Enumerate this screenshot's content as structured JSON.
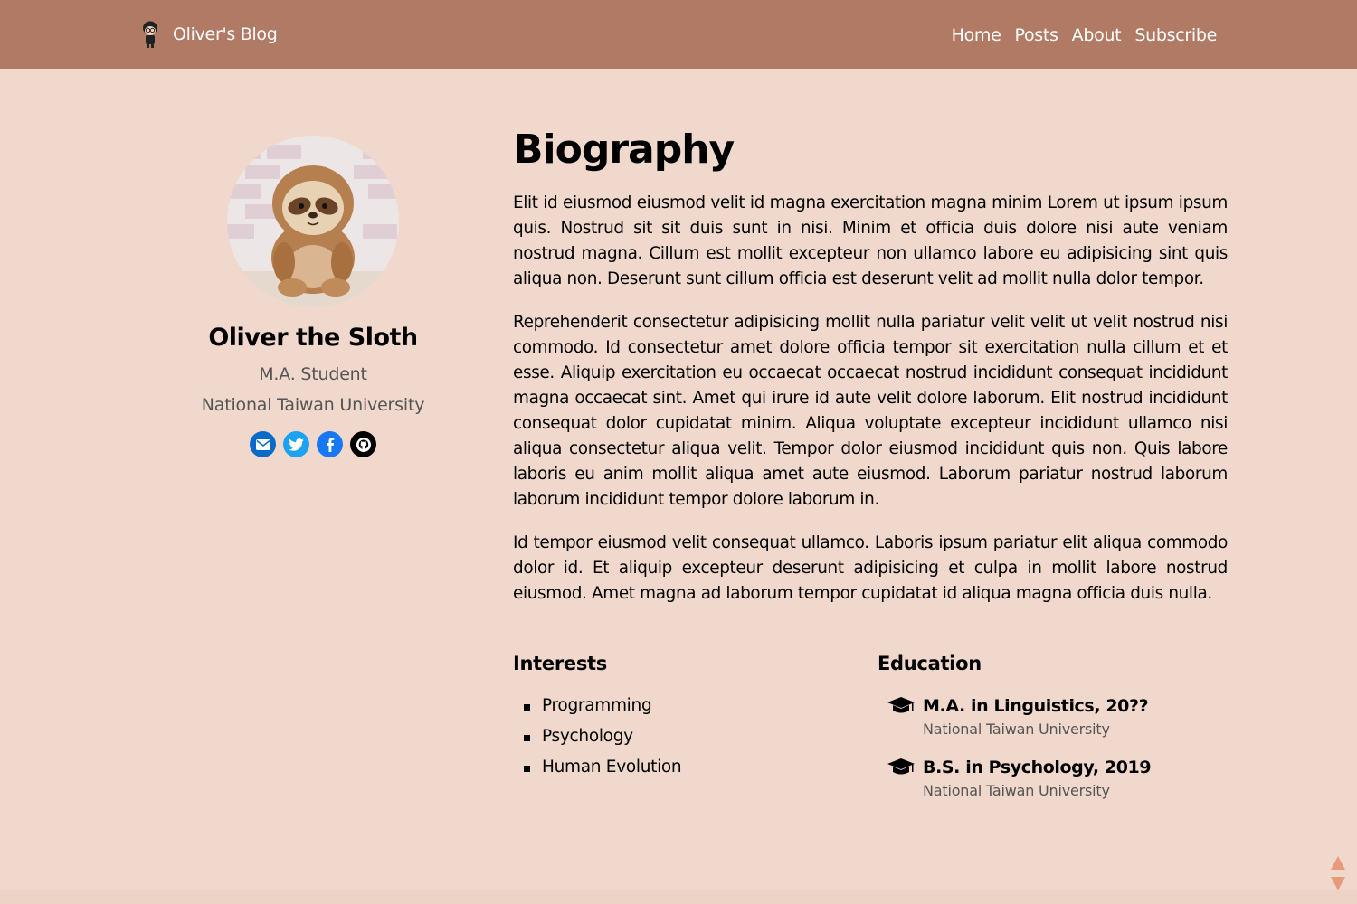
{
  "navbar": {
    "brand": "Oliver's Blog",
    "links": [
      "Home",
      "Posts",
      "About",
      "Subscribe"
    ]
  },
  "profile": {
    "name": "Oliver the Sloth",
    "role": "M.A. Student",
    "organization": "National Taiwan University",
    "social": [
      "email-icon",
      "twitter-icon",
      "facebook-icon",
      "github-icon"
    ]
  },
  "biography": {
    "title": "Biography",
    "paragraphs": [
      "Elit id eiusmod eiusmod velit id magna exercitation magna minim Lorem ut ipsum ipsum quis. Nostrud sit sit duis sunt in nisi. Minim et officia duis dolore nisi aute veniam nostrud magna. Cillum est mollit excepteur non ullamco labore eu adipisicing sint quis aliqua non. Deserunt sunt cillum officia est deserunt velit ad mollit nulla dolor tempor.",
      "Reprehenderit consectetur adipisicing mollit nulla pariatur velit velit ut velit nostrud nisi commodo. Id consectetur amet dolore officia tempor sit exercitation nulla cillum et et esse. Aliquip exercitation eu occaecat occaecat nostrud incididunt consequat incididunt magna occaecat sint. Amet qui irure id aute velit dolore laborum. Elit nostrud incididunt consequat dolor cupidatat minim. Aliqua voluptate excepteur incididunt ullamco nisi aliqua consectetur aliqua velit. Tempor dolor eiusmod incididunt quis non. Quis labore laboris eu anim mollit aliqua amet aute eiusmod. Laborum pariatur nostrud laborum laborum incididunt tempor dolore laborum in.",
      "Id tempor eiusmod velit consequat ullamco. Laboris ipsum pariatur elit aliqua commodo dolor id. Et aliquip excepteur deserunt adipisicing et culpa in mollit labore nostrud eiusmod. Amet magna ad laborum tempor cupidatat id aliqua magna officia duis nulla."
    ]
  },
  "interests": {
    "title": "Interests",
    "items": [
      "Programming",
      "Psychology",
      "Human Evolution"
    ]
  },
  "education": {
    "title": "Education",
    "items": [
      {
        "degree": "M.A. in Linguistics, 20??",
        "school": "National Taiwan University"
      },
      {
        "degree": "B.S. in Psychology, 2019",
        "school": "National Taiwan University"
      }
    ]
  },
  "colors": {
    "navbar": "#b07a64",
    "page": "#f0d9cc",
    "email": "#0a6ac8",
    "twitter": "#1da1f2",
    "facebook": "#1877f2",
    "github": "#000000",
    "scroll": "#e79b7c"
  }
}
